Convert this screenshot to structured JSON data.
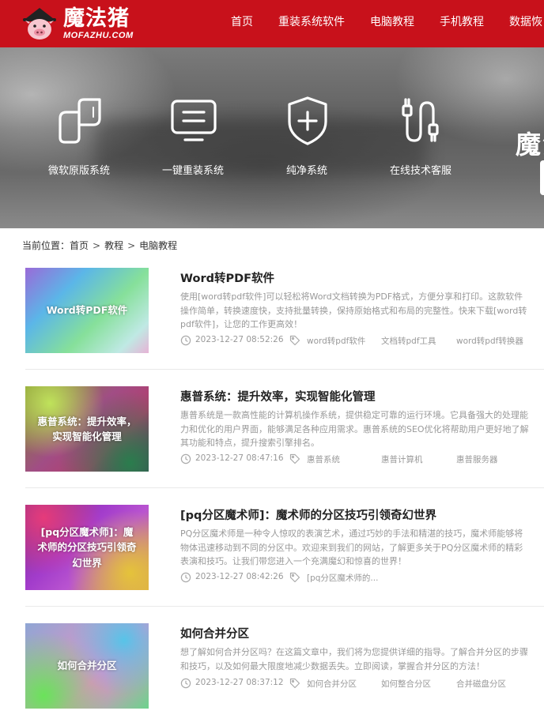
{
  "header": {
    "logo_cn": "魔法猪",
    "logo_en": "MOFAZHU.COM",
    "brand_color": "#c8111b",
    "nav": [
      "首页",
      "重装系统软件",
      "电脑教程",
      "手机教程",
      "数据恢"
    ]
  },
  "banner": {
    "services": [
      {
        "label": "微软原版系统",
        "icon": "microsoft-leaf-icon"
      },
      {
        "label": "一键重装系统",
        "icon": "monitor-icon"
      },
      {
        "label": "纯净系统",
        "icon": "shield-plus-icon"
      },
      {
        "label": "在线技术客服",
        "icon": "usb-cable-icon"
      }
    ],
    "title": "魔法"
  },
  "breadcrumb": {
    "prefix": "当前位置：",
    "items": [
      "首页",
      "教程",
      "电脑教程"
    ],
    "separator": ">"
  },
  "articles": [
    {
      "thumb_text": "Word转PDF软件",
      "title": "Word转PDF软件",
      "desc": "使用[word转pdf软件]可以轻松将Word文档转换为PDF格式，方便分享和打印。这款软件操作简单，转换速度快，支持批量转换，保持原始格式和布局的完整性。快来下载[word转pdf软件]，让您的工作更高效！",
      "date": "2023-12-27 08:52:26",
      "tags": [
        "word转pdf软件",
        "文档转pdf工具",
        "word转pdf转换器"
      ]
    },
    {
      "thumb_text": "惠普系统：提升效率，实现智能化管理",
      "title": "惠普系统：提升效率，实现智能化管理",
      "desc": "惠普系统是一款高性能的计算机操作系统，提供稳定可靠的运行环境。它具备强大的处理能力和优化的用户界面，能够满足各种应用需求。惠普系统的SEO优化将帮助用户更好地了解其功能和特点，提升搜索引擎排名。",
      "date": "2023-12-27 08:47:16",
      "tags": [
        "惠普系统",
        "惠普计算机",
        "惠普服务器"
      ]
    },
    {
      "thumb_text": "[pq分区魔术师]：魔术师的分区技巧引领奇幻世界",
      "title": "[pq分区魔术师]：魔术师的分区技巧引领奇幻世界",
      "desc": "PQ分区魔术师是一种令人惊叹的表演艺术，通过巧妙的手法和精湛的技巧，魔术师能够将物体迅速移动到不同的分区中。欢迎来到我们的网站，了解更多关于PQ分区魔术师的精彩表演和技巧。让我们带您进入一个充满魔幻和惊喜的世界！",
      "date": "2023-12-27 08:42:26",
      "tags": [
        "[pq分区魔术师的..."
      ]
    },
    {
      "thumb_text": "如何合并分区",
      "title": "如何合并分区",
      "desc": "想了解如何合并分区吗？在这篇文章中，我们将为您提供详细的指导。了解合并分区的步骤和技巧，以及如何最大限度地减少数据丢失。立即阅读，掌握合并分区的方法！",
      "date": "2023-12-27 08:37:12",
      "tags": [
        "如何合并分区",
        "如何整合分区",
        "合并磁盘分区"
      ]
    }
  ]
}
